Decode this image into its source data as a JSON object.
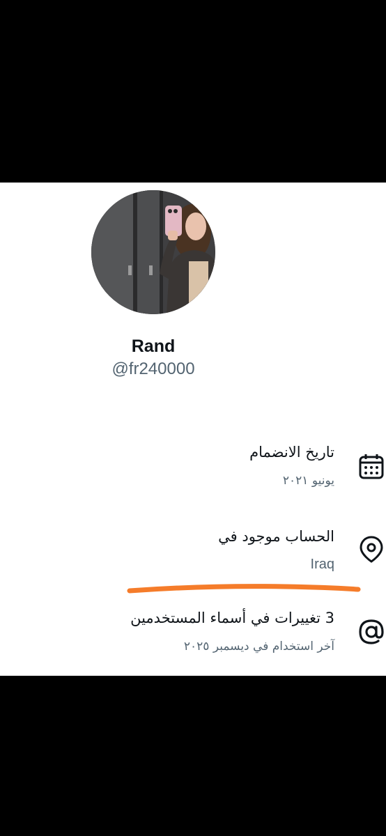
{
  "profile": {
    "display_name": "Rand",
    "handle": "@fr240000"
  },
  "about": {
    "joined": {
      "title": "تاريخ الانضمام",
      "value": "يونيو ٢٠٢١",
      "icon": "calendar-icon"
    },
    "location": {
      "title": "الحساب موجود في",
      "value": "Iraq",
      "icon": "location-pin-icon"
    },
    "username_changes": {
      "title": "3 تغييرات في أسماء المستخدمين",
      "value": "آخر استخدام في ديسمبر ٢٠٢٥",
      "icon": "at-sign-icon"
    }
  },
  "colors": {
    "highlight_stroke": "#f57c2a",
    "primary_text": "#0f1419",
    "secondary_text": "#536471"
  }
}
